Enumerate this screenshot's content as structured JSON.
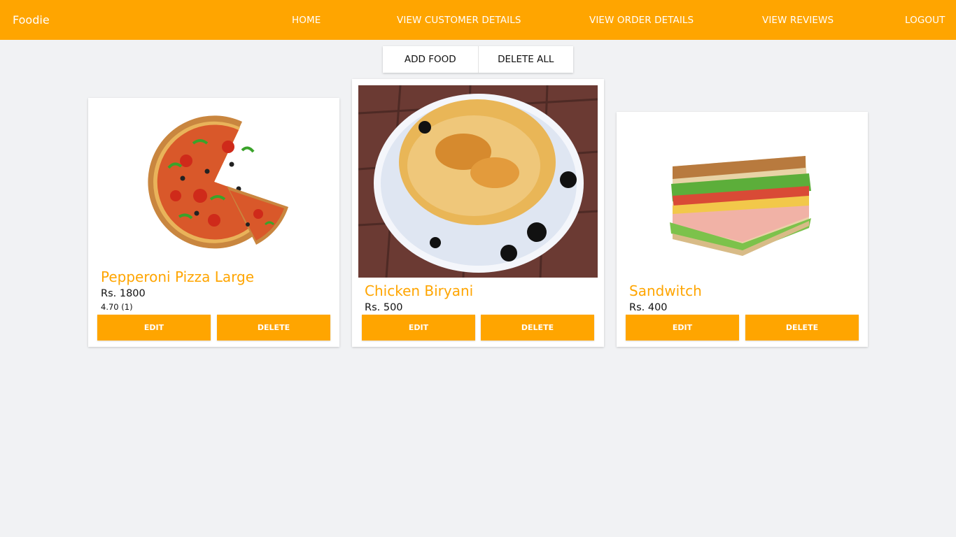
{
  "navbar": {
    "brand": "Foodie",
    "links": [
      "HOME",
      "VIEW CUSTOMER DETAILS",
      "VIEW ORDER DETAILS",
      "VIEW REVIEWS",
      "LOGOUT"
    ],
    "background": "#ffa500"
  },
  "toolbar": {
    "add_label": "ADD FOOD",
    "delete_all_label": "DELETE ALL"
  },
  "foods": [
    {
      "name": "Pepperoni Pizza Large",
      "price": "Rs. 1800",
      "rating": "4.70 (1)",
      "image": "pizza",
      "edit_label": "EDIT",
      "delete_label": "DELETE"
    },
    {
      "name": "Chicken Biryani",
      "price": "Rs. 500",
      "image": "biryani",
      "edit_label": "EDIT",
      "delete_label": "DELETE"
    },
    {
      "name": "Sandwitch",
      "price": "Rs. 400",
      "image": "sandwich",
      "edit_label": "EDIT",
      "delete_label": "DELETE"
    }
  ],
  "colors": {
    "accent": "#ffa500",
    "page_background": "#f1f2f4"
  }
}
